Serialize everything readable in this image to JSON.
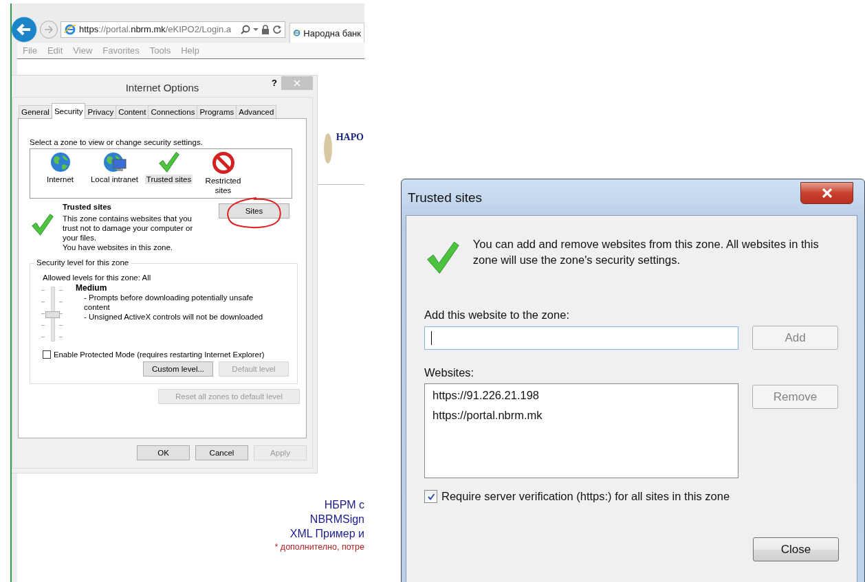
{
  "browser": {
    "address": "**https**://portal.**nbrm.mk**/eKIPO2/Login.a",
    "tab_title": "Народна банк",
    "menu": [
      {
        "label": "File"
      },
      {
        "label": "Edit"
      },
      {
        "label": "View"
      },
      {
        "label": "Favorites"
      },
      {
        "label": "Tools"
      },
      {
        "label": "Help"
      }
    ]
  },
  "page": {
    "heading": "НАРО",
    "lines": [
      {
        "text": "НБРМ с",
        "kind": "link"
      },
      {
        "text": "NBRMSign",
        "kind": "link"
      },
      {
        "text": "XML Пример и",
        "kind": "link"
      },
      {
        "text": "* дополнително, потре",
        "kind": "note"
      }
    ]
  },
  "internet_options": {
    "title": "Internet Options",
    "help": "?",
    "tabs": [
      {
        "label": "General",
        "selected": false
      },
      {
        "label": "Security",
        "selected": true
      },
      {
        "label": "Privacy",
        "selected": false
      },
      {
        "label": "Content",
        "selected": false
      },
      {
        "label": "Connections",
        "selected": false
      },
      {
        "label": "Programs",
        "selected": false
      },
      {
        "label": "Advanced",
        "selected": false
      }
    ],
    "zone_prompt": "Select a zone to view or change security settings.",
    "zones": [
      {
        "label": "Internet",
        "kind": "globe",
        "selected": false
      },
      {
        "label": "Local intranet",
        "kind": "intranet",
        "selected": false
      },
      {
        "label": "Trusted sites",
        "kind": "check",
        "selected": true
      },
      {
        "label": "Restricted sites",
        "kind": "blocked",
        "selected": false
      }
    ],
    "zone_title": "Trusted sites",
    "zone_description": [
      "This zone contains websites that you trust not to damage your computer or your files.",
      "You have websites in this zone."
    ],
    "sites_button": {
      "label": "Sites",
      "disabled": false
    },
    "security_level": {
      "group_label": "Security level for this zone",
      "allowed": "Allowed levels for this zone: All",
      "level": 0.5,
      "level_name": "Medium",
      "bullets": [
        "- Prompts before downloading potentially unsafe content",
        "- Unsigned ActiveX controls will not be downloaded"
      ],
      "protected_mode": {
        "label": "Enable Protected Mode (requires restarting Internet Explorer)",
        "checked": false
      },
      "buttons": [
        {
          "label": "Custom level...",
          "disabled": false
        },
        {
          "label": "Default level",
          "disabled": true
        }
      ]
    },
    "reset_button": {
      "label": "Reset all zones to default level",
      "disabled": true
    },
    "footer_buttons": [
      {
        "label": "OK",
        "disabled": false
      },
      {
        "label": "Cancel",
        "disabled": false
      },
      {
        "label": "Apply",
        "disabled": true
      }
    ]
  },
  "trusted_sites": {
    "title": "Trusted sites",
    "intro": "You can add and remove websites from this zone. All websites in this zone will use the zone's security settings.",
    "add_label": "Add this website to the zone:",
    "add_field": {
      "focused": true
    },
    "add_button": {
      "label": "Add",
      "disabled": true
    },
    "websites_label": "Websites:",
    "websites": [
      {
        "text": "https://91.226.21.198",
        "selected": false
      },
      {
        "text": "https://portal.nbrm.mk",
        "selected": false
      }
    ],
    "remove_button": {
      "label": "Remove",
      "disabled": true
    },
    "require_verification": {
      "label": "Require server verification (https:) for all sites in this zone",
      "checked": true
    },
    "close_button": {
      "label": "Close",
      "disabled": false
    }
  }
}
